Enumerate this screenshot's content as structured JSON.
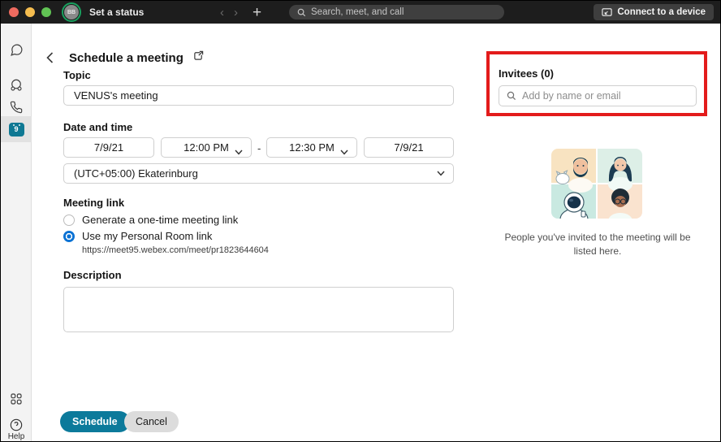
{
  "titlebar": {
    "status_label": "Set a status",
    "avatar_initials": "BB",
    "back_glyph": "‹",
    "forward_glyph": "›",
    "plus_glyph": "+",
    "search_placeholder": "Search, meet, and call",
    "connect_label": "Connect to a device"
  },
  "sidebar": {
    "meetings_badge": "9",
    "help_label": "Help"
  },
  "header": {
    "title": "Schedule a meeting"
  },
  "form": {
    "topic_label": "Topic",
    "topic_value": "VENUS's meeting",
    "datetime_label": "Date and time",
    "start_date": "7/9/21",
    "start_time": "12:00 PM",
    "range_separator": "-",
    "end_time": "12:30 PM",
    "end_date": "7/9/21",
    "timezone": "(UTC+05:00) Ekaterinburg",
    "meeting_link_label": "Meeting link",
    "radio_onetime_label": "Generate a one-time meeting link",
    "radio_personal_label": "Use my Personal Room link",
    "personal_room_url": "https://meet95.webex.com/meet/pr1823644604",
    "description_label": "Description",
    "description_value": "",
    "schedule_label": "Schedule",
    "cancel_label": "Cancel"
  },
  "invitees": {
    "title": "Invitees (0)",
    "search_placeholder": "Add by name or email",
    "empty_caption": "People you've invited to the meeting will be listed here."
  },
  "colors": {
    "accent_teal": "#0c7a9b",
    "badge_teal": "#0e7893",
    "radio_blue": "#0a72d4",
    "highlight_red": "#e31b1b",
    "presence_green": "#19a15f"
  }
}
